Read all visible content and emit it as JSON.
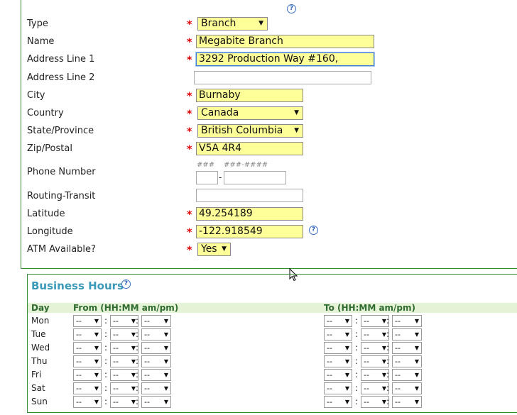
{
  "form": {
    "type": {
      "label": "Type",
      "value": "Branch"
    },
    "name": {
      "label": "Name",
      "value": "Megabite Branch"
    },
    "address1": {
      "label": "Address Line 1",
      "value": "3292 Production Way #160,"
    },
    "address2": {
      "label": "Address Line 2",
      "value": ""
    },
    "city": {
      "label": "City",
      "value": "Burnaby"
    },
    "country": {
      "label": "Country",
      "value": "Canada"
    },
    "state": {
      "label": "State/Province",
      "value": "British Columbia"
    },
    "zip": {
      "label": "Zip/Postal",
      "value": "V5A 4R4"
    },
    "phone": {
      "label": "Phone Number",
      "area_hint": "###",
      "number_hint": "###-####",
      "area": "",
      "number": "",
      "dash": "-"
    },
    "routing": {
      "label": "Routing-Transit",
      "value": ""
    },
    "latitude": {
      "label": "Latitude",
      "value": "49.254189"
    },
    "longitude": {
      "label": "Longitude",
      "value": "-122.918549"
    },
    "atm": {
      "label": "ATM Available?",
      "value": "Yes"
    },
    "required_mark": "*",
    "help_glyph": "?"
  },
  "business_hours": {
    "title": "Business Hours",
    "col_day": "Day",
    "col_from": "From (HH:MM am/pm)",
    "col_to": "To (HH:MM am/pm)",
    "placeholder": "--",
    "days": [
      "Mon",
      "Tue",
      "Wed",
      "Thu",
      "Fri",
      "Sat",
      "Sun"
    ]
  },
  "colors": {
    "required": "#dd0000",
    "field_fill": "#ffff99",
    "section_title": "#3a9ab8",
    "header_band": "#e4f2d6"
  },
  "icons": {
    "help": "help-circle-icon",
    "dropdown": "dropdown-arrow-icon"
  }
}
